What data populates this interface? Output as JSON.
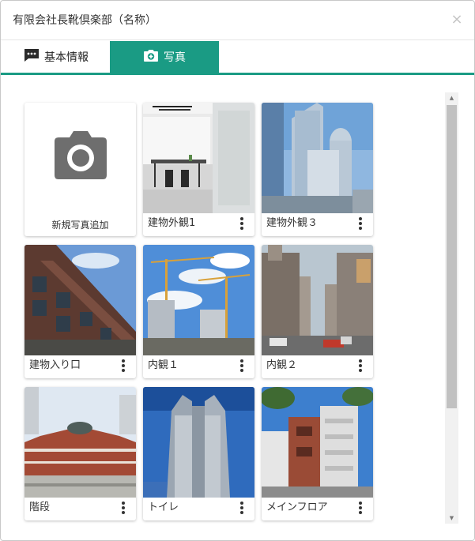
{
  "modal": {
    "title": "有限会社長靴倶楽部（名称）",
    "close_glyph": "×"
  },
  "tabs": [
    {
      "label": "基本情報",
      "icon": "comment-dots-icon"
    },
    {
      "label": "写真",
      "icon": "camera-plus-icon",
      "active": true
    }
  ],
  "add_photo": {
    "label": "新規写真追加"
  },
  "photos": [
    {
      "caption": "建物外観1",
      "scene": "office-interior"
    },
    {
      "caption": "建物外観３",
      "scene": "skyscraper-towers"
    },
    {
      "caption": "建物入り口",
      "scene": "apartment-facade"
    },
    {
      "caption": "内観１",
      "scene": "construction-cranes"
    },
    {
      "caption": "内観２",
      "scene": "city-intersection"
    },
    {
      "caption": "階段",
      "scene": "red-brick-station"
    },
    {
      "caption": "トイレ",
      "scene": "twin-tower"
    },
    {
      "caption": "メインフロア",
      "scene": "brick-apartment"
    }
  ],
  "colors": {
    "accent": "#1a9b84"
  }
}
